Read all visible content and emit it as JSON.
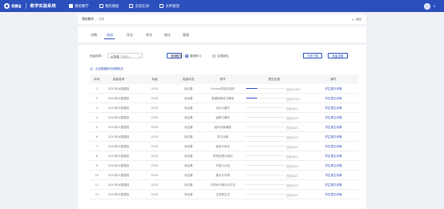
{
  "topnav": {
    "logo_text": "竞赛宝",
    "system_title": "教学实验系统",
    "items": [
      {
        "label": "我的教学",
        "icon": "teaching-icon",
        "active": true
      },
      {
        "label": "我的课程",
        "icon": "course-icon",
        "active": false
      },
      {
        "label": "实验实训",
        "icon": "lab-icon",
        "active": false
      },
      {
        "label": "文件管理",
        "icon": "folder-icon",
        "active": false
      }
    ]
  },
  "breadcrumb": {
    "current": "我的教学",
    "sep": "/",
    "page": "详情"
  },
  "back_label": "返回",
  "tabs": [
    {
      "label": "详情",
      "active": false
    },
    {
      "label": "实训",
      "active": true
    },
    {
      "label": "作业",
      "active": false
    },
    {
      "label": "考试",
      "active": false
    },
    {
      "label": "统计",
      "active": false
    },
    {
      "label": "管理",
      "active": false
    }
  ],
  "filter": {
    "label": "班级选择：",
    "select_value": "AI角课 / 2015 ...",
    "query_button": "查 询",
    "mode_label": "查阅模型：",
    "option_1": "模型练习",
    "option_2": "实验报告",
    "button_1": "已到下载",
    "button_2": "批量设置"
  },
  "note": "注：点击数据即可查看批次",
  "table": {
    "headers": [
      "序号",
      "班级名称",
      "年级",
      "班级状态",
      "章节",
      "提交进度",
      "操作"
    ],
    "rows": [
      {
        "no": "1",
        "class": "2020年大数据班",
        "grade": "2015",
        "status": "未结课",
        "chapter": "Python语言及范例",
        "progress": 0.3,
        "ptext": "已交5人/5人",
        "op": "学生提交详情"
      },
      {
        "no": "2",
        "class": "2020年大数据班",
        "grade": "2015",
        "status": "未结课",
        "chapter": "数据库概念与基础",
        "progress": 0.3,
        "ptext": "已交5人/5人",
        "op": "学生提交详情"
      },
      {
        "no": "3",
        "class": "2020年大数据班",
        "grade": "2015",
        "status": "未结课",
        "chapter": "流水与循环",
        "progress": 0.0,
        "ptext": "已交0/5人",
        "op": "学生提交详情"
      },
      {
        "no": "4",
        "class": "2020年大数据班",
        "grade": "2015",
        "status": "未结课",
        "chapter": "函数与模块",
        "progress": 0.0,
        "ptext": "已交0/5人",
        "op": "学生提交详情"
      },
      {
        "no": "5",
        "class": "2020年大数据班",
        "grade": "2015",
        "status": "未结课",
        "chapter": "面向对象编程",
        "progress": 0.0,
        "ptext": "已交0/5人",
        "op": "学生提交详情"
      },
      {
        "no": "6",
        "class": "2020年大数据班",
        "grade": "2015",
        "status": "未结课",
        "chapter": "类与对象",
        "progress": 0.0,
        "ptext": "已交0/5人",
        "op": "学生提交详情"
      },
      {
        "no": "7",
        "class": "2020年大数据班",
        "grade": "2015",
        "status": "未结课",
        "chapter": "继承与多态",
        "progress": 0.0,
        "ptext": "已交0/5人",
        "op": "学生提交详情"
      },
      {
        "no": "8",
        "class": "2020年大数据班",
        "grade": "2015",
        "status": "未结课",
        "chapter": "异常处理与调试",
        "progress": 0.0,
        "ptext": "已交0/5人",
        "op": "学生提交详情"
      },
      {
        "no": "9",
        "class": "2020年大数据班",
        "grade": "2015",
        "status": "未结课",
        "chapter": "列表与元组",
        "progress": 0.0,
        "ptext": "已交0/5人",
        "op": "学生提交详情"
      },
      {
        "no": "10",
        "class": "2020年大数据班",
        "grade": "2015",
        "status": "未结课",
        "chapter": "集合与字典",
        "progress": 0.0,
        "ptext": "已交0/5人",
        "op": "学生提交详情"
      },
      {
        "no": "11",
        "class": "2020年大数据班",
        "grade": "2015",
        "status": "未结课",
        "chapter": "字符串与格式化方法",
        "progress": 0.0,
        "ptext": "已交0/5人",
        "op": "学生提交详情"
      },
      {
        "no": "12",
        "class": "2020年大数据班",
        "grade": "2015",
        "status": "未结课",
        "chapter": "正则表达式",
        "progress": 0.0,
        "ptext": "已交0/5人",
        "op": "学生提交详情"
      }
    ]
  },
  "colors": {
    "accent": "#2b4fbd",
    "background": "#eef1f6"
  }
}
